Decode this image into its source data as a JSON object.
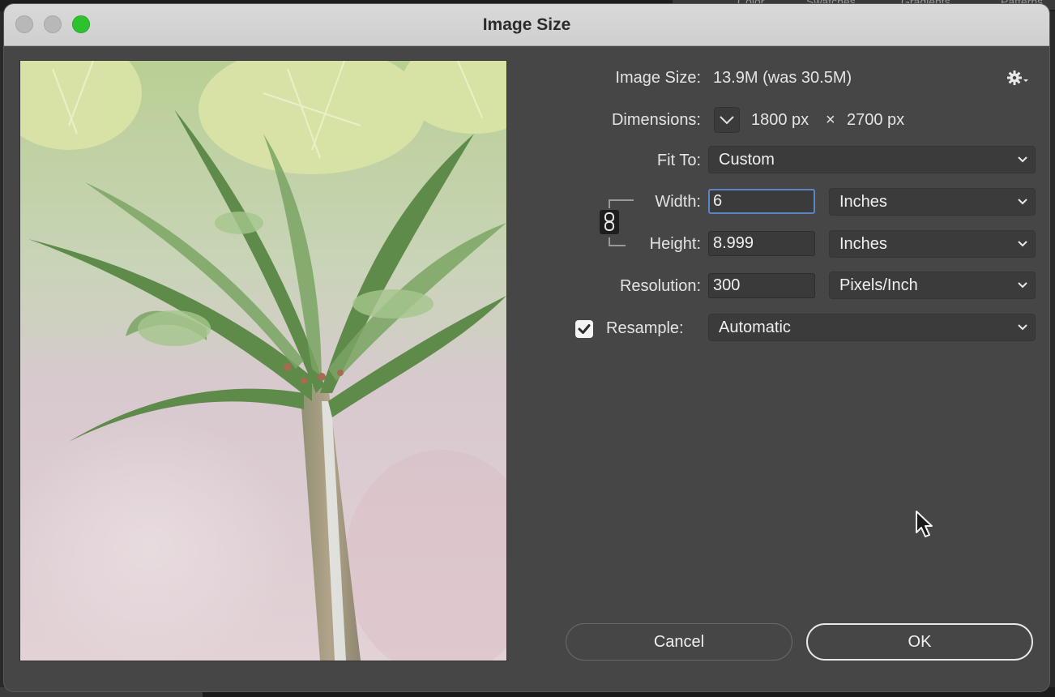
{
  "background_tabs": [
    "Color",
    "Swatches",
    "Gradients",
    "Patterns"
  ],
  "dialog": {
    "title": "Image Size",
    "image_size_label": "Image Size:",
    "image_size_value": "13.9M (was 30.5M)",
    "dimensions_label": "Dimensions:",
    "dimensions_width": "1800 px",
    "dimensions_times": "×",
    "dimensions_height": "2700 px",
    "fit_to_label": "Fit To:",
    "fit_to_value": "Custom",
    "width_label": "Width:",
    "width_value": "6",
    "width_unit": "Inches",
    "height_label": "Height:",
    "height_value": "8.999",
    "height_unit": "Inches",
    "resolution_label": "Resolution:",
    "resolution_value": "300",
    "resolution_unit": "Pixels/Inch",
    "resample_label": "Resample:",
    "resample_checked": true,
    "resample_value": "Automatic",
    "cancel_label": "Cancel",
    "ok_label": "OK"
  },
  "icons": {
    "settings": "gear-icon",
    "dimensions_toggle": "chevron-down-icon",
    "constrain": "link-icon",
    "checkbox": "checkmark-icon",
    "cursor": "pointer-cursor-icon"
  },
  "colors": {
    "dialog_bg": "#464646",
    "titlebar_bg": "#d4d4d4",
    "field_bg": "#3a3a3a",
    "focus_ring": "#5b84c6",
    "zoom_button": "#2ec22e"
  }
}
